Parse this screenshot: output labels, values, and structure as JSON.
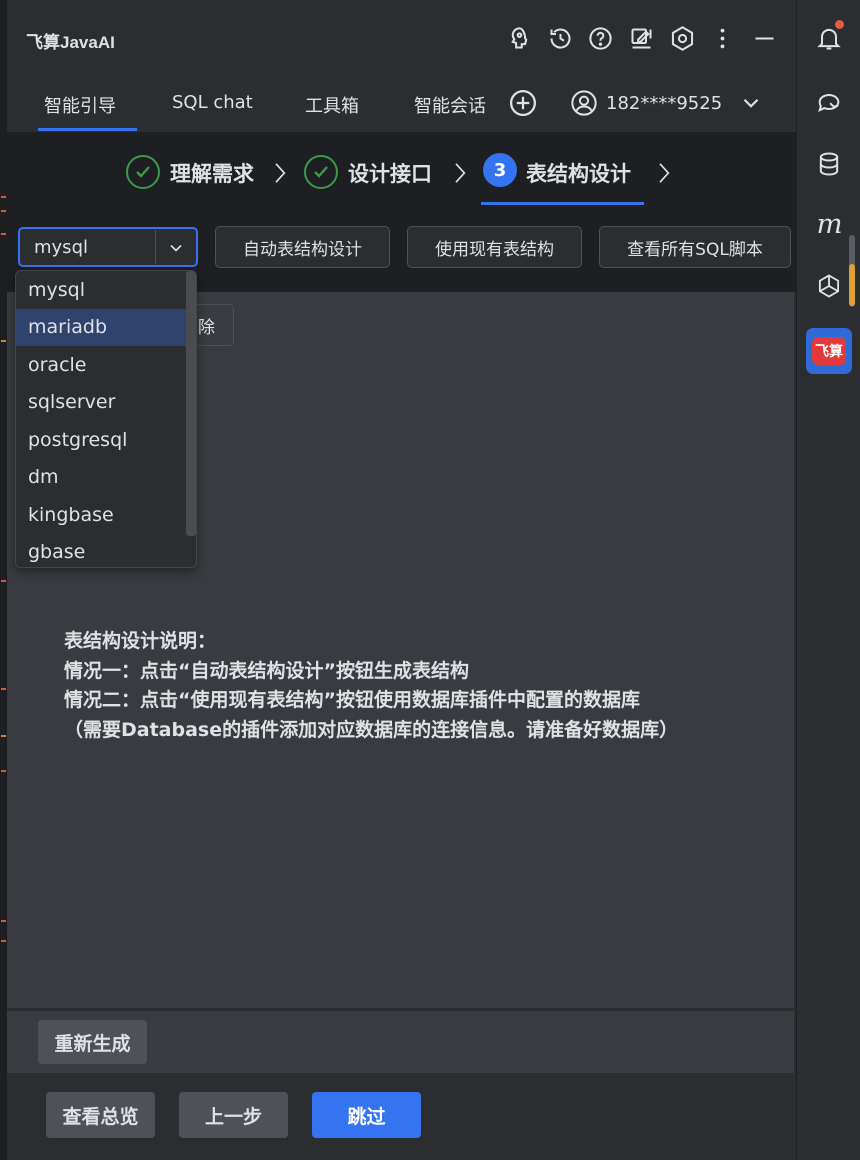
{
  "app": {
    "title": "飞算JavaAI"
  },
  "titlebar": {
    "icons": [
      "brain-icon",
      "history-icon",
      "help-icon",
      "edit-icon",
      "settings-icon",
      "more-icon",
      "minimize-icon"
    ]
  },
  "tabs": [
    {
      "label": "智能引导",
      "active": true
    },
    {
      "label": "SQL chat"
    },
    {
      "label": "工具箱"
    },
    {
      "label": "智能会话"
    }
  ],
  "user": {
    "phone": "182****9525"
  },
  "steps": [
    {
      "label": "理解需求",
      "status": "done"
    },
    {
      "label": "设计接口",
      "status": "done"
    },
    {
      "number": "3",
      "label": "表结构设计",
      "status": "active"
    }
  ],
  "toolbar": {
    "db_select_value": "mysql",
    "buttons": [
      "自动表结构设计",
      "使用现有表结构",
      "查看所有SQL脚本"
    ]
  },
  "dropdown": {
    "options": [
      "mysql",
      "mariadb",
      "oracle",
      "sqlserver",
      "postgresql",
      "dm",
      "kingbase",
      "gbase"
    ],
    "highlighted": "mariadb"
  },
  "content": {
    "partial_button": "除",
    "instructions": [
      "表结构设计说明：",
      "情况一：点击“自动表结构设计”按钮生成表结构",
      "情况二：点击“使用现有表结构”按钮使用数据库插件中配置的数据库",
      "（需要Database的插件添加对应数据库的连接信息。请准备好数据库）"
    ]
  },
  "actions": {
    "regenerate": "重新生成",
    "overview": "查看总览",
    "prev": "上一步",
    "skip": "跳过"
  },
  "sidebar": {
    "logo_text": "飞算",
    "icons": [
      "notification-icon",
      "ai-chat-icon",
      "database-icon",
      "m-icon",
      "openai-icon"
    ]
  },
  "colors": {
    "accent": "#3574f0",
    "success": "#3d9a48",
    "panel": "#2b2d30",
    "content": "#393b40"
  }
}
